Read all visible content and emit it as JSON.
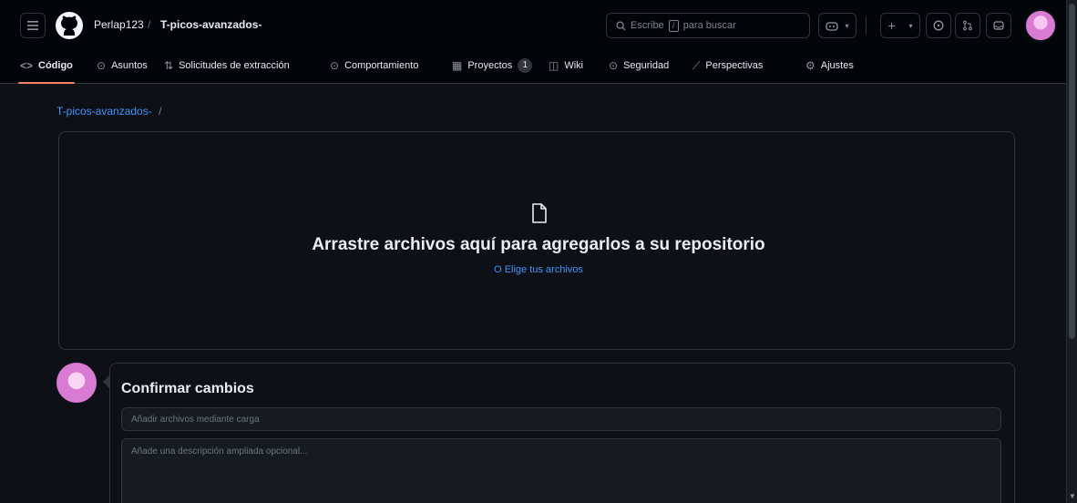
{
  "header": {
    "owner": "Perlap123",
    "separator": "/",
    "repo": "T-picos-avanzados-",
    "search_placeholder": "Escribe",
    "search_key": "/",
    "search_suffix": "para buscar"
  },
  "tabs": [
    {
      "label": "Código",
      "icon": "code-icon",
      "active": true
    },
    {
      "label": "Asuntos",
      "icon": "issue-icon"
    },
    {
      "label": "Solicitudes de extracción",
      "icon": "pull-request-icon"
    },
    {
      "label": "Comportamiento",
      "icon": "play-icon"
    },
    {
      "label": "Proyectos",
      "icon": "table-icon",
      "count": "1"
    },
    {
      "label": "Wiki",
      "icon": "book-icon"
    },
    {
      "label": "Seguridad",
      "icon": "shield-icon"
    },
    {
      "label": "Perspectivas",
      "icon": "graph-icon"
    },
    {
      "label": "Ajustes",
      "icon": "gear-icon"
    }
  ],
  "breadcrumb": {
    "repo": "T-picos-avanzados-",
    "slash": "/"
  },
  "upload": {
    "title": "Arrastre archivos aquí para agregarlos a su repositorio",
    "link": "O Elige tus archivos"
  },
  "commit": {
    "title": "Confirmar cambios",
    "summary_placeholder": "Añadir archivos mediante carga",
    "description_placeholder": "Añade una descripción ampliada opcional..."
  },
  "colors": {
    "background": "#0d1117",
    "header": "#010409",
    "link": "#4493f8",
    "active_tab_underline": "#f78166",
    "border": "#30363d"
  }
}
